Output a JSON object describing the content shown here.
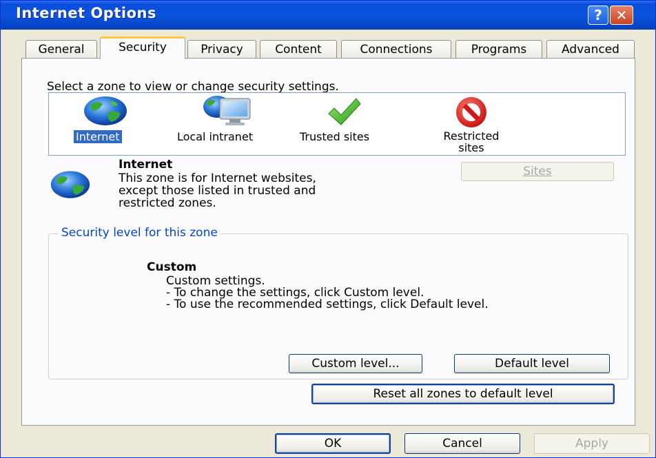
{
  "window": {
    "title": "Internet Options",
    "help_symbol": "?",
    "close_symbol": "✕"
  },
  "tabs": [
    {
      "label": "General"
    },
    {
      "label": "Security",
      "active": true
    },
    {
      "label": "Privacy"
    },
    {
      "label": "Content"
    },
    {
      "label": "Connections"
    },
    {
      "label": "Programs"
    },
    {
      "label": "Advanced"
    }
  ],
  "zones": {
    "prompt": "Select a zone to view or change security settings.",
    "items": [
      {
        "label": "Internet",
        "icon": "globe-icon",
        "selected": true
      },
      {
        "label": "Local intranet",
        "icon": "intranet-icon"
      },
      {
        "label": "Trusted sites",
        "icon": "checkmark-icon"
      },
      {
        "label": "Restricted",
        "label2": "sites",
        "icon": "no-entry-icon"
      }
    ]
  },
  "zone_info": {
    "title": "Internet",
    "desc_lines": [
      "This zone is for Internet websites,",
      "except those listed in trusted and",
      "restricted zones."
    ],
    "sites_button": "Sites",
    "sites_enabled": false
  },
  "security_level": {
    "legend": "Security level for this zone",
    "level_name": "Custom",
    "lines": [
      "Custom settings.",
      "- To change the settings, click Custom level.",
      "- To use the recommended settings, click Default level."
    ],
    "custom_level_button": "Custom level...",
    "default_level_button": "Default level"
  },
  "reset_all_button": "Reset all zones to default level",
  "footer": {
    "ok": "OK",
    "cancel": "Cancel",
    "apply": "Apply",
    "apply_enabled": false
  },
  "colors": {
    "titlebar": "#0b53e0",
    "selection": "#316ac5",
    "groupbox_legend": "#0046d5",
    "dialog_bg": "#ece9d8"
  }
}
